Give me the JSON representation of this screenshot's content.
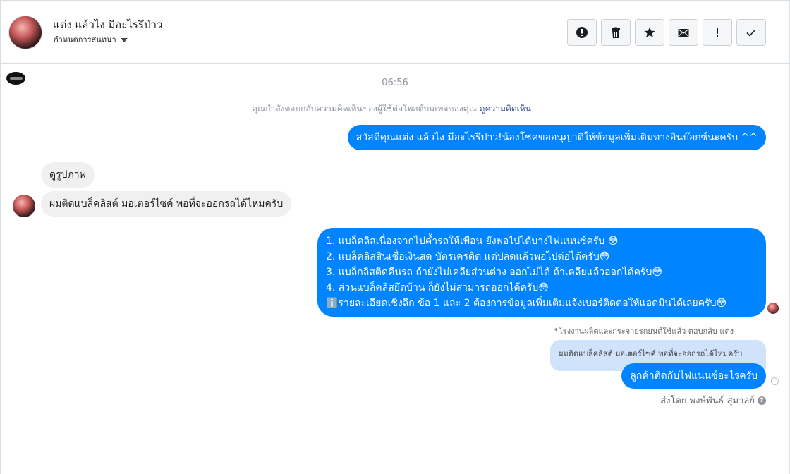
{
  "header": {
    "contact_name": "แต่ง แล้วไง มีอะไรรึป่าว",
    "subtitle": "กำหนดการสนทนา",
    "tools": [
      {
        "name": "report-icon"
      },
      {
        "name": "trash-icon"
      },
      {
        "name": "star-icon"
      },
      {
        "name": "envelope-icon"
      },
      {
        "name": "exclamation-icon"
      },
      {
        "name": "check-icon"
      }
    ]
  },
  "conversation": {
    "timestamp": "06:56",
    "reply_note": "คุณกำลังตอบกลับความคิดเห็นของผู้ใช้ต่อโพสต์บนเพจของคุณ",
    "reply_note_link": "ดูความคิดเห็น",
    "messages": [
      {
        "from": "page",
        "text": "สวัสดีคุณแต่ง แล้วไง มีอะไรรึป่าว!น้องโชคขออนุญาติให้ข้อมูลเพิ่มเติมทางอินบ๊อกซ์นะครับ ^^"
      },
      {
        "from": "user",
        "text": "ดูรูปภาพ"
      },
      {
        "from": "user",
        "text": "ผมติดแบล็คลิสต์ มอเตอร์ไซค์ พอที่จะออกรถได้ไหมครับ"
      },
      {
        "from": "page",
        "lines": [
          "1. แบล็คลิสเนื่องจากไปค้ำรถให้เพื่อน ยังพอไปได้บางไฟแนนซ์ครับ 😳",
          "2. แบล็คลิสสินเชื่อเงินสด บัตรเครดิต แต่ปลดแล้วพอไปต่อได้ครับ😳",
          "3. แบล็กลิสติดคืนรถ ถ้ายังไม่เคลียส่วนต่าง ออกไม่ได้ ถ้าเคลียแล้วออกได้ครับ😳",
          "4. ส่วนแบล็คลิสยึดบ้าน ก็ยังไม่สามารถออกได้ครับ😳",
          "ℹ️รายละเอียดเชิงลึก ข้อ 1 และ 2 ต้องการข้อมูลเพิ่มเติมแจ้งเบอร์ติดต่อให้แอดมินได้เลยครับ😳"
        ]
      }
    ],
    "reply_to_label": "↱โรงงานผลิตและกระจายรถยนต์ใช้แล้ว ตอบกลับ แต่ง",
    "quoted_text": "ผมติดแบล็คลิสต์ มอเตอร์ไซค์ พอที่จะออกรถได้ไหมครับ",
    "last_reply": "ลูกค้าติดกับไฟแนนซ์อะไรครับ",
    "sent_by": "ส่งโดย พงษ์พันธ์ สุมาลย์",
    "help_symbol": "?"
  }
}
